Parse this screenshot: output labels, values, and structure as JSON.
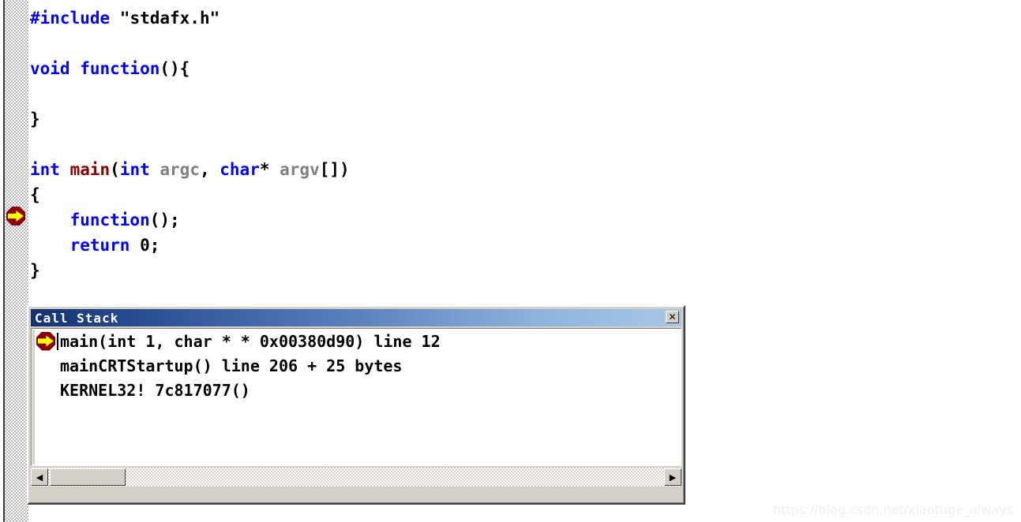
{
  "editor": {
    "name": "source-code-editor",
    "background_color": "#ffffff",
    "gutter_color": "#b9b9b9",
    "colors": {
      "keyword": "#0000ff",
      "function_name": "#8b0000",
      "identifier": "#808080",
      "punctuation": "#000000",
      "marker_badge": "#8b0000",
      "marker_arrow": "#ffff00"
    },
    "execution_marker_icon": "yellow-arrow-marker",
    "execution_marker_line_index": 7,
    "lines": [
      {
        "tokens": [
          {
            "t": "#include ",
            "c": "kw"
          },
          {
            "t": "\"stdafx.h\"",
            "c": "pn"
          }
        ]
      },
      {
        "tokens": []
      },
      {
        "tokens": [
          {
            "t": "void ",
            "c": "kw"
          },
          {
            "t": "function",
            "c": "kw"
          },
          {
            "t": "(){",
            "c": "pn"
          }
        ]
      },
      {
        "tokens": []
      },
      {
        "tokens": [
          {
            "t": "}",
            "c": "pn"
          }
        ]
      },
      {
        "tokens": []
      },
      {
        "tokens": [
          {
            "t": "int ",
            "c": "kw"
          },
          {
            "t": "main",
            "c": "fn"
          },
          {
            "t": "(",
            "c": "pn"
          },
          {
            "t": "int ",
            "c": "kw"
          },
          {
            "t": "argc",
            "c": "id"
          },
          {
            "t": ", ",
            "c": "pn"
          },
          {
            "t": "char",
            "c": "kw"
          },
          {
            "t": "* ",
            "c": "pn"
          },
          {
            "t": "argv",
            "c": "id"
          },
          {
            "t": "[])",
            "c": "pn"
          }
        ]
      },
      {
        "tokens": [
          {
            "t": "{",
            "c": "pn"
          }
        ]
      },
      {
        "tokens": [
          {
            "t": "    ",
            "c": "pn"
          },
          {
            "t": "function",
            "c": "kw"
          },
          {
            "t": "();",
            "c": "pn"
          }
        ]
      },
      {
        "tokens": [
          {
            "t": "    ",
            "c": "pn"
          },
          {
            "t": "return ",
            "c": "kw"
          },
          {
            "t": "0",
            "c": "pn"
          },
          {
            "t": ";",
            "c": "pn"
          }
        ]
      },
      {
        "tokens": [
          {
            "t": "}",
            "c": "pn"
          }
        ]
      }
    ]
  },
  "call_stack_window": {
    "title": "Call Stack",
    "close_button_label": "✕",
    "close_icon": "close-x-icon",
    "titlebar_gradient_start": "#133271",
    "titlebar_gradient_end": "#a8c8e8",
    "frame_color": "#d4d0c8",
    "rows": [
      {
        "text": "main(int 1, char * * 0x00380d90) line 12",
        "current": true,
        "marker_icon": "yellow-arrow-marker",
        "has_caret": true
      },
      {
        "text": "mainCRTStartup() line 206 + 25 bytes",
        "current": false,
        "marker_icon": "",
        "has_caret": false
      },
      {
        "text": "KERNEL32! 7c817077()",
        "current": false,
        "marker_icon": "",
        "has_caret": false
      }
    ],
    "scrollbar": {
      "left_arrow_label": "◀",
      "right_arrow_label": "▶",
      "left_arrow_icon": "scroll-left-arrow-icon",
      "right_arrow_icon": "scroll-right-arrow-icon",
      "thumb_name": "horizontal-scroll-thumb"
    }
  },
  "watermark": {
    "text": "https://blog.csdn.net/xiaotuge_always",
    "color": "#f0f0f0"
  }
}
